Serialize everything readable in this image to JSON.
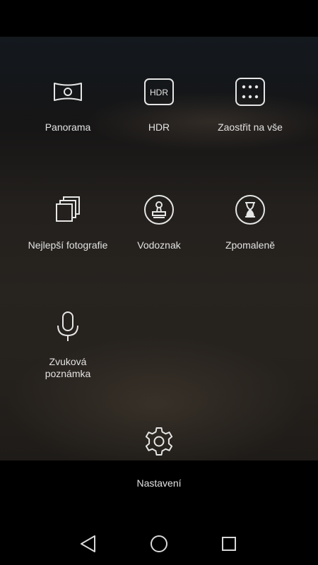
{
  "modes": [
    {
      "label": "Panorama",
      "icon": "panorama-icon"
    },
    {
      "label": "HDR",
      "icon": "hdr-icon",
      "icon_text": "HDR"
    },
    {
      "label": "Zaostřit na vše",
      "icon": "all-focus-icon"
    },
    {
      "label": "Nejlepší fotografie",
      "icon": "best-photo-icon"
    },
    {
      "label": "Vodoznak",
      "icon": "watermark-stamp-icon"
    },
    {
      "label": "Zpomaleně",
      "icon": "hourglass-icon"
    },
    {
      "label": "Zvuková poznámka",
      "icon": "microphone-icon"
    }
  ],
  "settings": {
    "label": "Nastavení",
    "icon": "gear-icon"
  },
  "navbar": {
    "back": "back-triangle-icon",
    "home": "home-circle-icon",
    "recents": "recents-square-icon"
  },
  "colors": {
    "icon": "#e6e6e6",
    "background": "#000000"
  }
}
